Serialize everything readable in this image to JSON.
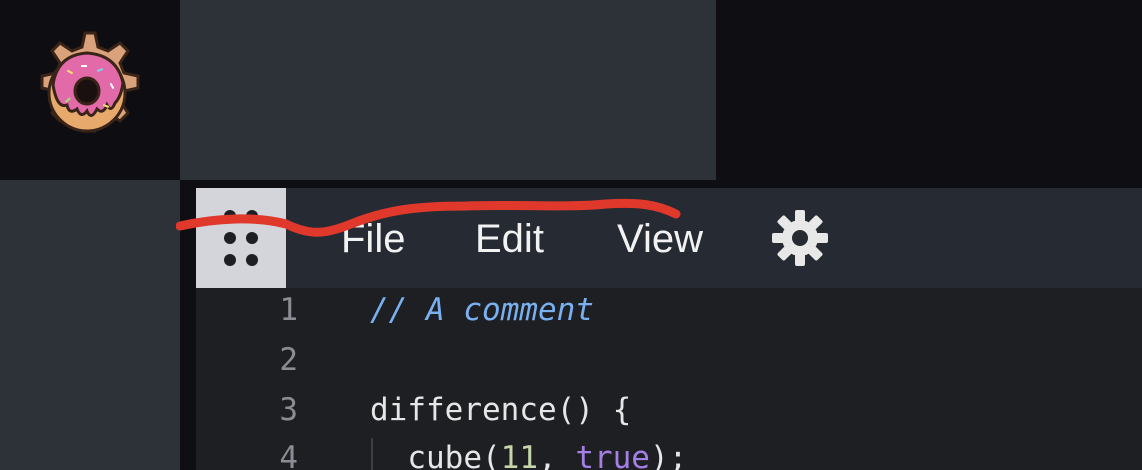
{
  "app": {
    "logo_icon": "donut-gear-logo"
  },
  "menubar": {
    "handle_icon": "drag-handle-dots",
    "items": [
      {
        "label": "File"
      },
      {
        "label": "Edit"
      },
      {
        "label": "View"
      }
    ],
    "settings_icon": "gear-icon"
  },
  "editor": {
    "lines": [
      {
        "number": "1",
        "comment": "// A comment"
      },
      {
        "number": "2",
        "text": ""
      },
      {
        "number": "3",
        "text": "difference() {"
      },
      {
        "number": "4",
        "prefix": "  cube(",
        "number_value": "11",
        "sep": ", ",
        "keyword": "true",
        "suffix": ");"
      }
    ]
  },
  "colors": {
    "menubar_bg": "#262a33",
    "editor_bg": "#1d1f23",
    "comment": "#7ab0f0",
    "keyword": "#a47fe6",
    "annotation_scribble": "#e0392b"
  }
}
